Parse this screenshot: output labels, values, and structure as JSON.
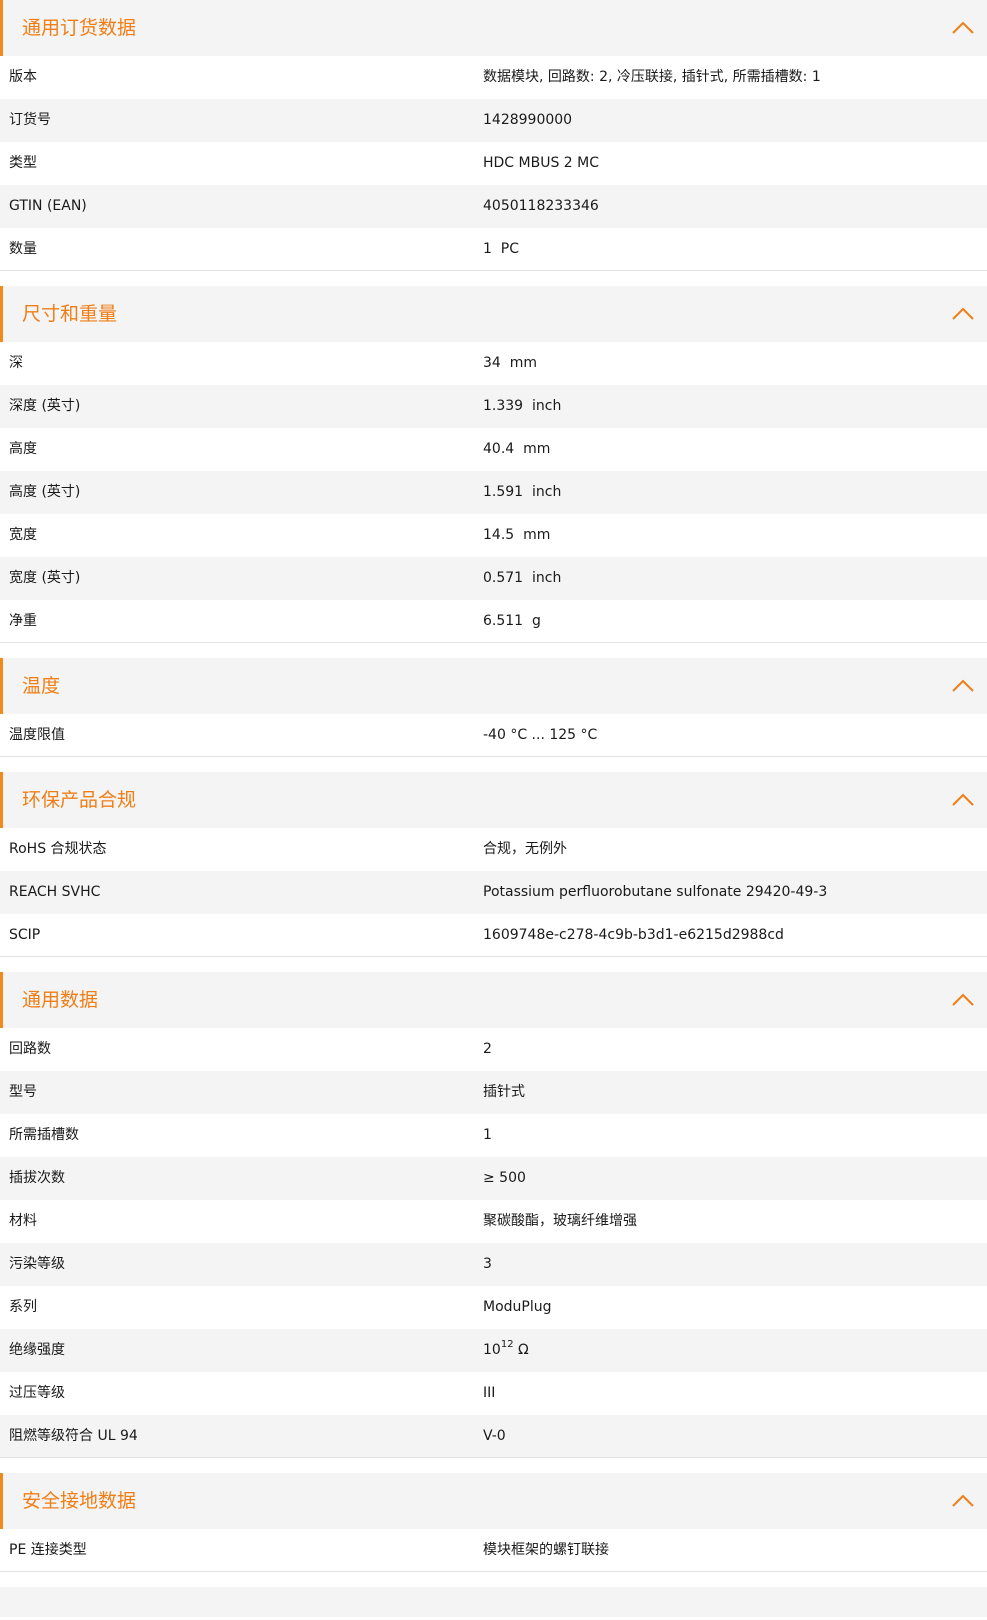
{
  "accent_color": "#f07e17",
  "sections": [
    {
      "title": "通用订货数据",
      "rows": [
        {
          "label": "版本",
          "value": "数据模块, 回路数: 2, 冷压联接, 插针式, 所需插槽数: 1"
        },
        {
          "label": "订货号",
          "value": "1428990000"
        },
        {
          "label": "类型",
          "value": "HDC MBUS 2 MC"
        },
        {
          "label": "GTIN (EAN)",
          "value": "4050118233346"
        },
        {
          "label": "数量",
          "value": "1  PC"
        }
      ]
    },
    {
      "title": "尺寸和重量",
      "rows": [
        {
          "label": "深",
          "value": "34  mm"
        },
        {
          "label": "深度 (英寸)",
          "value": "1.339  inch"
        },
        {
          "label": "高度",
          "value": "40.4  mm"
        },
        {
          "label": "高度 (英寸)",
          "value": "1.591  inch"
        },
        {
          "label": "宽度",
          "value": "14.5  mm"
        },
        {
          "label": "宽度 (英寸)",
          "value": "0.571  inch"
        },
        {
          "label": "净重",
          "value": "6.511  g"
        }
      ]
    },
    {
      "title": "温度",
      "rows": [
        {
          "label": "温度限值",
          "value": "-40 °C ... 125 °C"
        }
      ]
    },
    {
      "title": "环保产品合规",
      "rows": [
        {
          "label": "RoHS 合规状态",
          "value": "合规，无例外"
        },
        {
          "label": "REACH SVHC",
          "value": "Potassium perfluorobutane sulfonate 29420-49-3"
        },
        {
          "label": "SCIP",
          "value": "1609748e-c278-4c9b-b3d1-e6215d2988cd"
        }
      ]
    },
    {
      "title": "通用数据",
      "rows": [
        {
          "label": "回路数",
          "value": "2"
        },
        {
          "label": "型号",
          "value": "插针式"
        },
        {
          "label": "所需插槽数",
          "value": "1"
        },
        {
          "label": "插拔次数",
          "value": "≥ 500"
        },
        {
          "label": "材料",
          "value": "聚碳酸酯，玻璃纤维增强"
        },
        {
          "label": "污染等级",
          "value": "3"
        },
        {
          "label": "系列",
          "value": "ModuPlug"
        },
        {
          "label": "绝缘强度",
          "value": "10",
          "sup": "12",
          "suffix": " Ω"
        },
        {
          "label": "过压等级",
          "value": "III"
        },
        {
          "label": "阻燃等级符合 UL 94",
          "value": "V-0"
        }
      ]
    },
    {
      "title": "安全接地数据",
      "rows": [
        {
          "label": "PE 连接类型",
          "value": "模块框架的螺钉联接"
        }
      ]
    }
  ]
}
